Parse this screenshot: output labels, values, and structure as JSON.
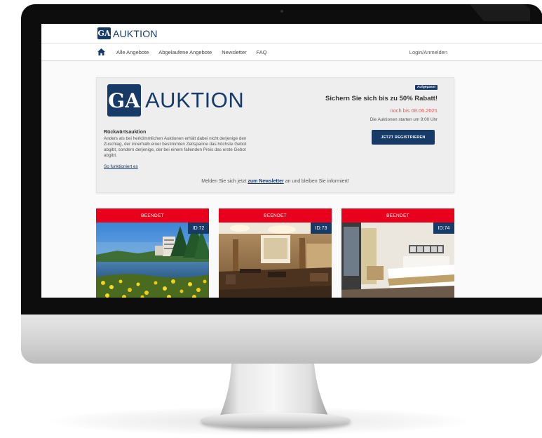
{
  "header": {
    "logo_mark": "GA",
    "brand": "AUKTION"
  },
  "nav": {
    "items": [
      "Alle Angebote",
      "Abgelaufene Angebote",
      "Newsletter",
      "FAQ"
    ],
    "login": "Login/Anmelden"
  },
  "hero": {
    "logo_mark": "GA",
    "brand": "AUKTION",
    "subtitle": "Rückwärtsauktion",
    "body": "Anders als bei herkömmlichen Auktionen erhält dabei nicht derjenige den Zuschlag, der innerhalb einer bestimmten Zeitspanne das höchste Gebot abgibt, sondern derjenige, der bei einem fallenden Preis das erste Gebot abgibt.",
    "link": "So funktioniert es",
    "badge": "Aufgepasst",
    "promo_title": "Sichern Sie sich bis zu 50% Rabatt!",
    "promo_date": "noch bis 08.06.2021",
    "promo_start": "Die Auktionen starten um 9:00 Uhr",
    "register_button": "JETZT REGISTRIEREN",
    "newsletter_prefix": "Melden Sie sich jetzt",
    "newsletter_link": "zum Newsletter",
    "newsletter_suffix": "an und bleiben Sie informiert!"
  },
  "cards": [
    {
      "status": "BEENDET",
      "id": "ID:72",
      "image": "lake-hotel-photo"
    },
    {
      "status": "BEENDET",
      "id": "ID:73",
      "image": "lobby-photo"
    },
    {
      "status": "BEENDET",
      "id": "ID:74",
      "image": "hotel-room-photo"
    }
  ],
  "colors": {
    "brand_navy": "#173a66",
    "status_red": "#e8001c",
    "promo_red": "#e8524a"
  }
}
